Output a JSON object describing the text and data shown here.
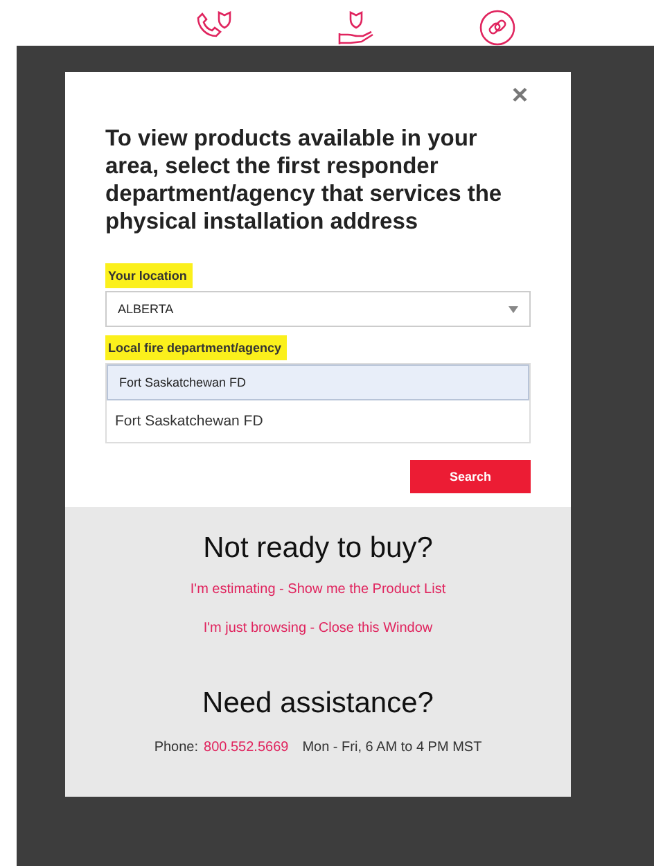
{
  "header_icons": [
    {
      "kind": "phone-shield"
    },
    {
      "kind": "hand-shield"
    },
    {
      "kind": "link"
    }
  ],
  "modal": {
    "close": "×",
    "heading": "To view products available in your area, select the first responder department/agency that services the physical installation address",
    "location": {
      "label": "Your location",
      "highlighted": true,
      "value": "ALBERTA"
    },
    "agency": {
      "label": "Local fire department/agency",
      "highlighted": true,
      "value": "Fort Saskatchewan FD",
      "suggestions": [
        "Fort Saskatchewan FD"
      ]
    },
    "search_button": "Search",
    "not_ready": {
      "heading": "Not ready to buy?",
      "links": [
        "I'm estimating - Show me the Product List",
        "I'm just browsing - Close this Window"
      ]
    },
    "assistance": {
      "heading": "Need assistance?",
      "phone_label": "Phone:",
      "phone": "800.552.5669",
      "hours": "Mon - Fri, 6 AM to 4 PM MST"
    }
  }
}
